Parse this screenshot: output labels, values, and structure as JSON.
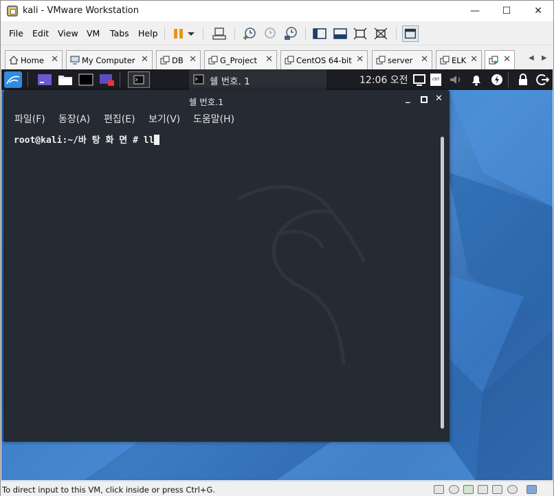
{
  "window": {
    "title": "kali - VMware Workstation"
  },
  "menubar": {
    "items": [
      "File",
      "Edit",
      "View",
      "VM",
      "Tabs",
      "Help"
    ]
  },
  "tabs": [
    {
      "label": "Home",
      "icon": "home-icon"
    },
    {
      "label": "My Computer",
      "icon": "computer-icon"
    },
    {
      "label": "DB",
      "icon": "vm-icon"
    },
    {
      "label": "G_Project",
      "icon": "vm-icon"
    },
    {
      "label": "CentOS 64-bit",
      "icon": "vm-icon"
    },
    {
      "label": "server",
      "icon": "vm-icon"
    },
    {
      "label": "ELK",
      "icon": "vm-icon"
    },
    {
      "label": "",
      "icon": "vm-running-icon"
    }
  ],
  "tab_close": "✕",
  "tab_scroll": {
    "left": "◀",
    "right": "▶"
  },
  "kali_panel": {
    "active_window": "쉘 번호. 1",
    "clock": "12:06 오전"
  },
  "terminal": {
    "title": "쉘 번호.1",
    "menu": [
      "파일(F)",
      "동장(A)",
      "편집(E)",
      "보기(V)",
      "도움말(H)"
    ],
    "prompt": "root@kali:~/바 탕 화 면 # ll"
  },
  "statusbar": {
    "text": "To direct input to this VM, click inside or press Ctrl+G."
  },
  "colors": {
    "terminal_bg": "#252a33",
    "kali_panel_bg": "#1b1d22",
    "desktop_blue": "#3b7ec9"
  }
}
